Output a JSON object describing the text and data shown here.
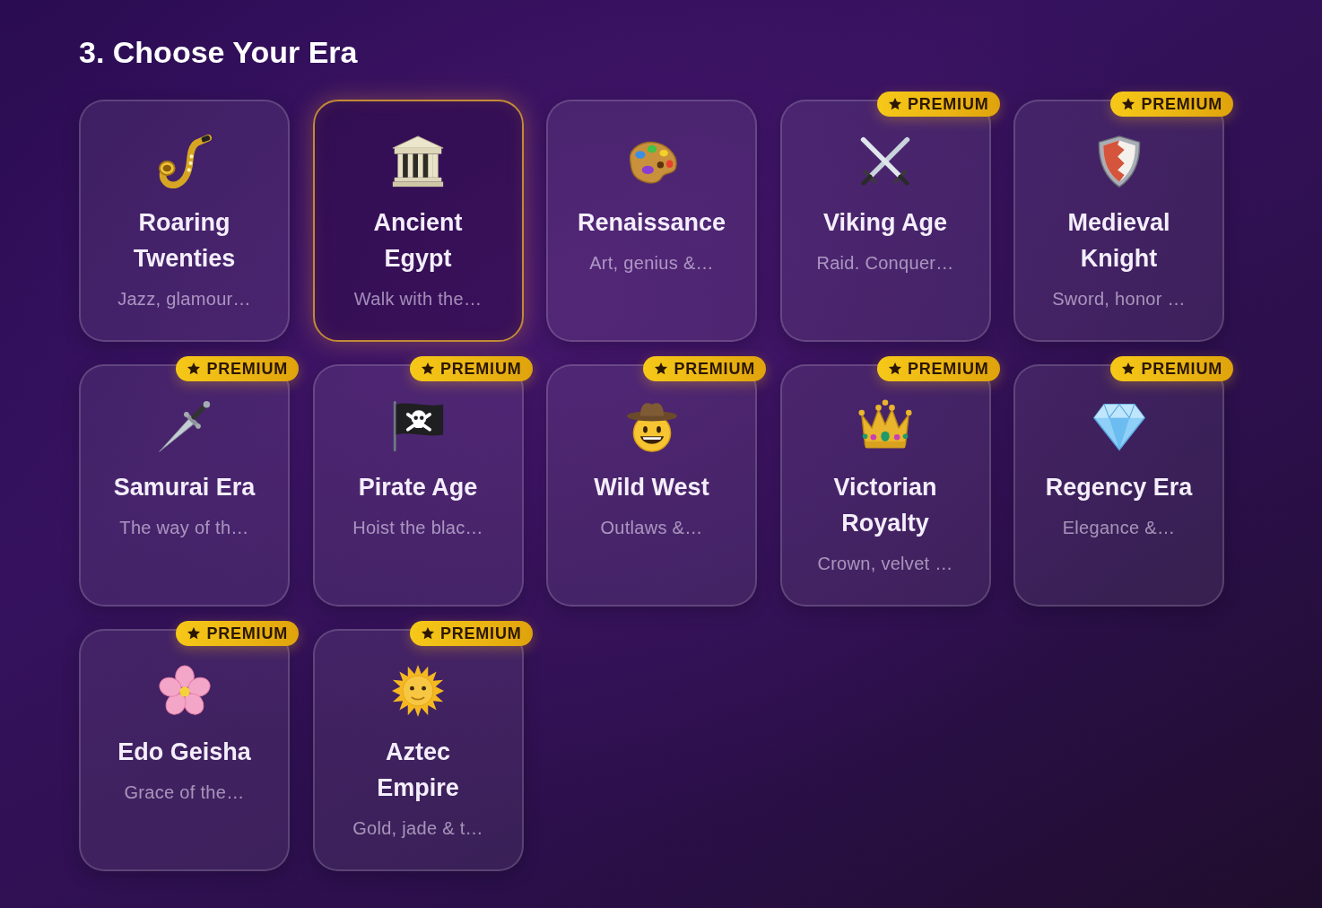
{
  "section": {
    "title": "3. Choose Your Era"
  },
  "eras": [
    {
      "title": "Roaring Twenties",
      "subtitle": "Jazz, glamour…",
      "selected": false
    },
    {
      "title": "Ancient Egypt",
      "subtitle": "Walk with the…",
      "selected": true
    },
    {
      "title": "Renaissance",
      "subtitle": "Art, genius &…",
      "selected": false
    },
    {
      "title": "Viking Age",
      "subtitle": "Raid. Conquer…",
      "selected": false,
      "badge": "PREMIUM"
    },
    {
      "title": "Medieval Knight",
      "subtitle": "Sword, honor …",
      "selected": false,
      "badge": "PREMIUM"
    },
    {
      "title": "Samurai Era",
      "subtitle": "The way of th…",
      "selected": false,
      "badge": "PREMIUM"
    },
    {
      "title": "Pirate Age",
      "subtitle": "Hoist the blac…",
      "selected": false,
      "badge": "PREMIUM"
    },
    {
      "title": "Wild West",
      "subtitle": "Outlaws &…",
      "selected": false,
      "badge": "PREMIUM"
    },
    {
      "title": "Victorian Royalty",
      "subtitle": "Crown, velvet …",
      "selected": false,
      "badge": "PREMIUM"
    },
    {
      "title": "Regency Era",
      "subtitle": "Elegance &…",
      "selected": false,
      "badge": "PREMIUM"
    },
    {
      "title": "Edo Geisha",
      "subtitle": "Grace of the…",
      "selected": false,
      "badge": "PREMIUM"
    },
    {
      "title": "Aztec Empire",
      "subtitle": "Gold, jade & t…",
      "selected": false,
      "badge": "PREMIUM"
    }
  ]
}
